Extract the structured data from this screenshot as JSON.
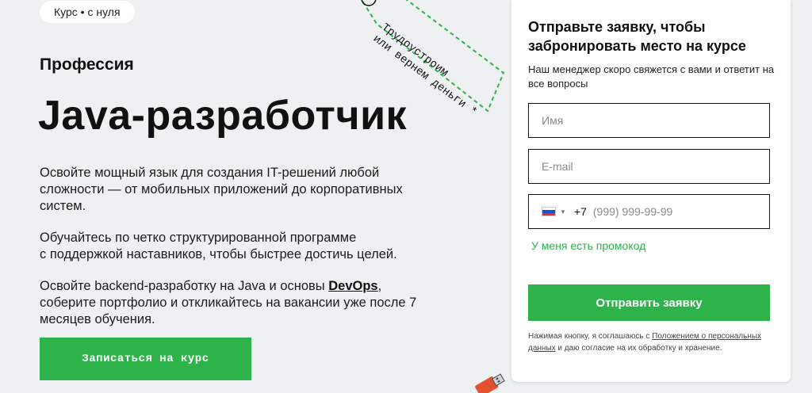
{
  "hero": {
    "chip": "Курс • с нуля",
    "subtitle": "Профессия",
    "title": "Java-разработчик",
    "para1": "Освойте мощный язык для создания IT-решений любой сложности — от мобильных приложений до корпоративных систем.",
    "para2_line1": "Обучайтесь по четко структурированной программе",
    "para2_line2": "с поддержкой наставников, чтобы быстрее достичь целей.",
    "para3_before": "Освойте backend-разработку на Java и основы ",
    "para3_link": "DevOps",
    "para3_after": ", соберите портфолио и откликайтесь на вакансии уже после 7 месяцев обучения.",
    "cta_label": "Записаться на курс"
  },
  "tag": {
    "line1": "Трудоустроим",
    "line2": "или вернем деньги *"
  },
  "form": {
    "title": "Отправьте заявку, чтобы забронировать место на курсе",
    "subtitle": "Наш менеджер скоро свяжется с вами и ответит на все вопросы",
    "name_placeholder": "Имя",
    "email_placeholder": "E-mail",
    "phone_code": "+7",
    "phone_placeholder": "(999) 999-99-99",
    "promo": "У меня есть промокод",
    "submit_label": "Отправить заявку",
    "legal_before": "Нажимая кнопку, я соглашаюсь с ",
    "legal_link": "Положением о персональных данных",
    "legal_after": " и даю согласие на их обработку и хранение."
  },
  "colors": {
    "accent": "#2eb24a",
    "background": "#eef0f2"
  },
  "icons": {
    "flag": "russia-flag-icon",
    "caret": "chevron-down-icon",
    "usb": "usb-drive-icon"
  }
}
